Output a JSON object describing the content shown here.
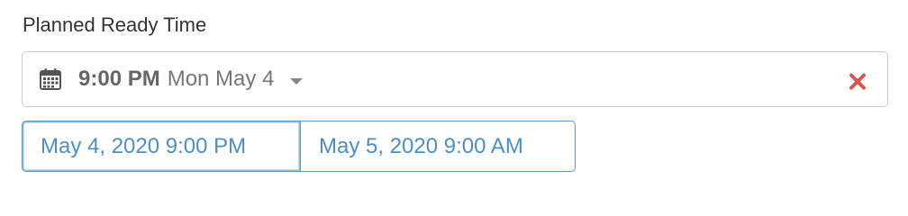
{
  "field": {
    "label": "Planned Ready Time"
  },
  "picker": {
    "time": "9:00 PM",
    "date": "Mon May 4",
    "icon": "calendar-icon",
    "clear_icon": "clear-icon",
    "clear_color": "#d9534f"
  },
  "quick_options": [
    {
      "label": "May 4, 2020 9:00 PM",
      "selected": true
    },
    {
      "label": "May 5, 2020 9:00 AM",
      "selected": false
    }
  ],
  "colors": {
    "accent": "#4a90c8",
    "border": "#cccccc",
    "text": "#333333"
  }
}
